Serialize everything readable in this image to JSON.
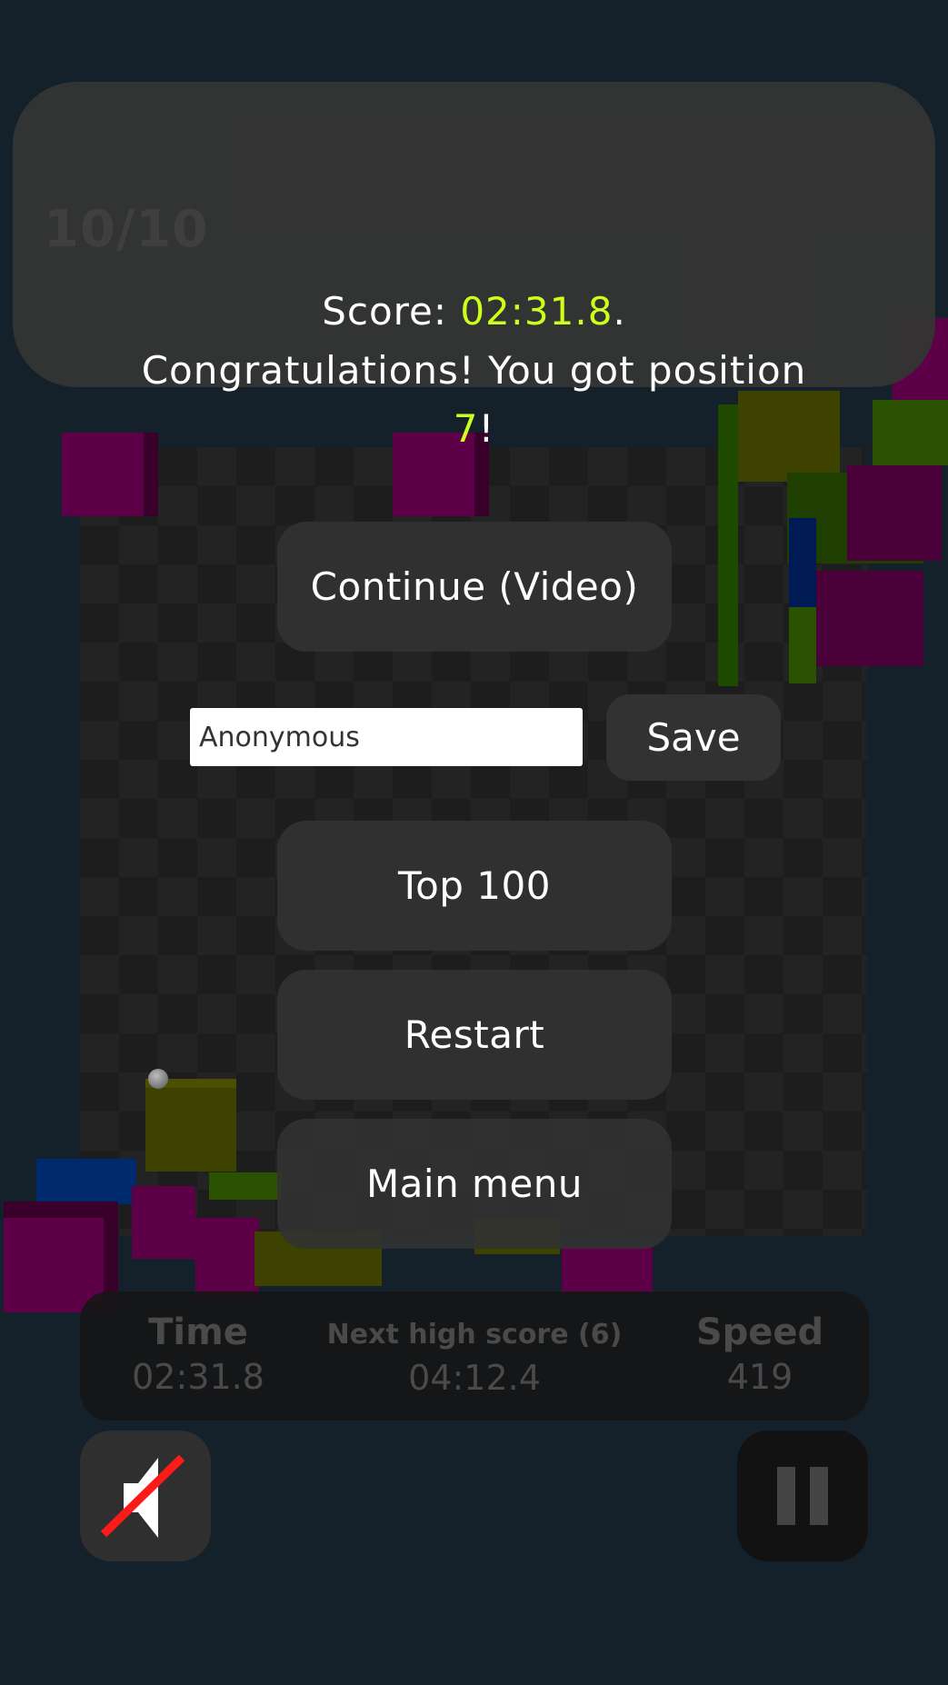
{
  "level": "10/10",
  "message": {
    "score_prefix": "Score: ",
    "score_value": "02:31.8",
    "score_suffix": ".",
    "congrats": "Congratulations! You got position",
    "position": "7",
    "position_suffix": "!"
  },
  "buttons": {
    "continue_video": "Continue (Video)",
    "top100": "Top 100",
    "restart": "Restart",
    "main_menu": "Main menu",
    "save": "Save"
  },
  "name_input": {
    "value": "Anonymous"
  },
  "stats": {
    "time_label": "Time",
    "time_value": "02:31.8",
    "next_label": "Next high score (6)",
    "next_value": "04:12.4",
    "speed_label": "Speed",
    "speed_value": "419"
  },
  "controls": {
    "sound_icon": "speaker-muted-icon",
    "pause_icon": "pause-icon"
  },
  "colors": {
    "highlight": "#ccff1a",
    "background": "#14202a",
    "cube_magenta": "#5e0048",
    "cube_olive": "#3d4200",
    "cube_green": "#2a5200",
    "cube_blue": "#002a6e"
  }
}
